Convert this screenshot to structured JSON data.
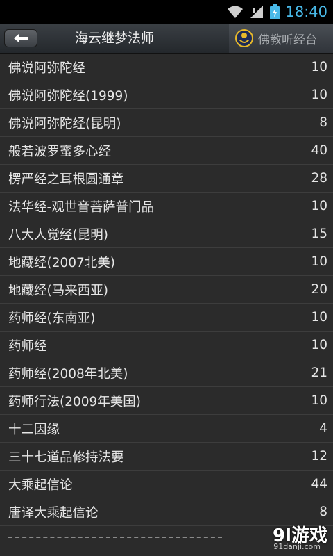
{
  "status": {
    "time": "18:40"
  },
  "header": {
    "title": "海云继梦法师",
    "brand": "佛教听经台"
  },
  "items": [
    {
      "title": "佛说阿弥陀经",
      "count": "10"
    },
    {
      "title": "佛说阿弥陀经(1999)",
      "count": "10"
    },
    {
      "title": "佛说阿弥陀经(昆明)",
      "count": "8"
    },
    {
      "title": "般若波罗蜜多心经",
      "count": "40"
    },
    {
      "title": "楞严经之耳根圆通章",
      "count": "28"
    },
    {
      "title": "法华经-观世音菩萨普门品",
      "count": "10"
    },
    {
      "title": "八大人觉经(昆明)",
      "count": "15"
    },
    {
      "title": "地藏经(2007北美)",
      "count": "10"
    },
    {
      "title": "地藏经(马来西亚)",
      "count": "20"
    },
    {
      "title": "药师经(东南亚)",
      "count": "10"
    },
    {
      "title": "药师经",
      "count": "10"
    },
    {
      "title": "药师经(2008年北美)",
      "count": "21"
    },
    {
      "title": "药师行法(2009年美国)",
      "count": "10"
    },
    {
      "title": "十二因缘",
      "count": "4"
    },
    {
      "title": "三十七道品修持法要",
      "count": "12"
    },
    {
      "title": "大乘起信论",
      "count": "44"
    },
    {
      "title": "唐译大乘起信论",
      "count": "8"
    }
  ],
  "watermark": {
    "main": "9l游戏",
    "sub": "91danji.com"
  }
}
